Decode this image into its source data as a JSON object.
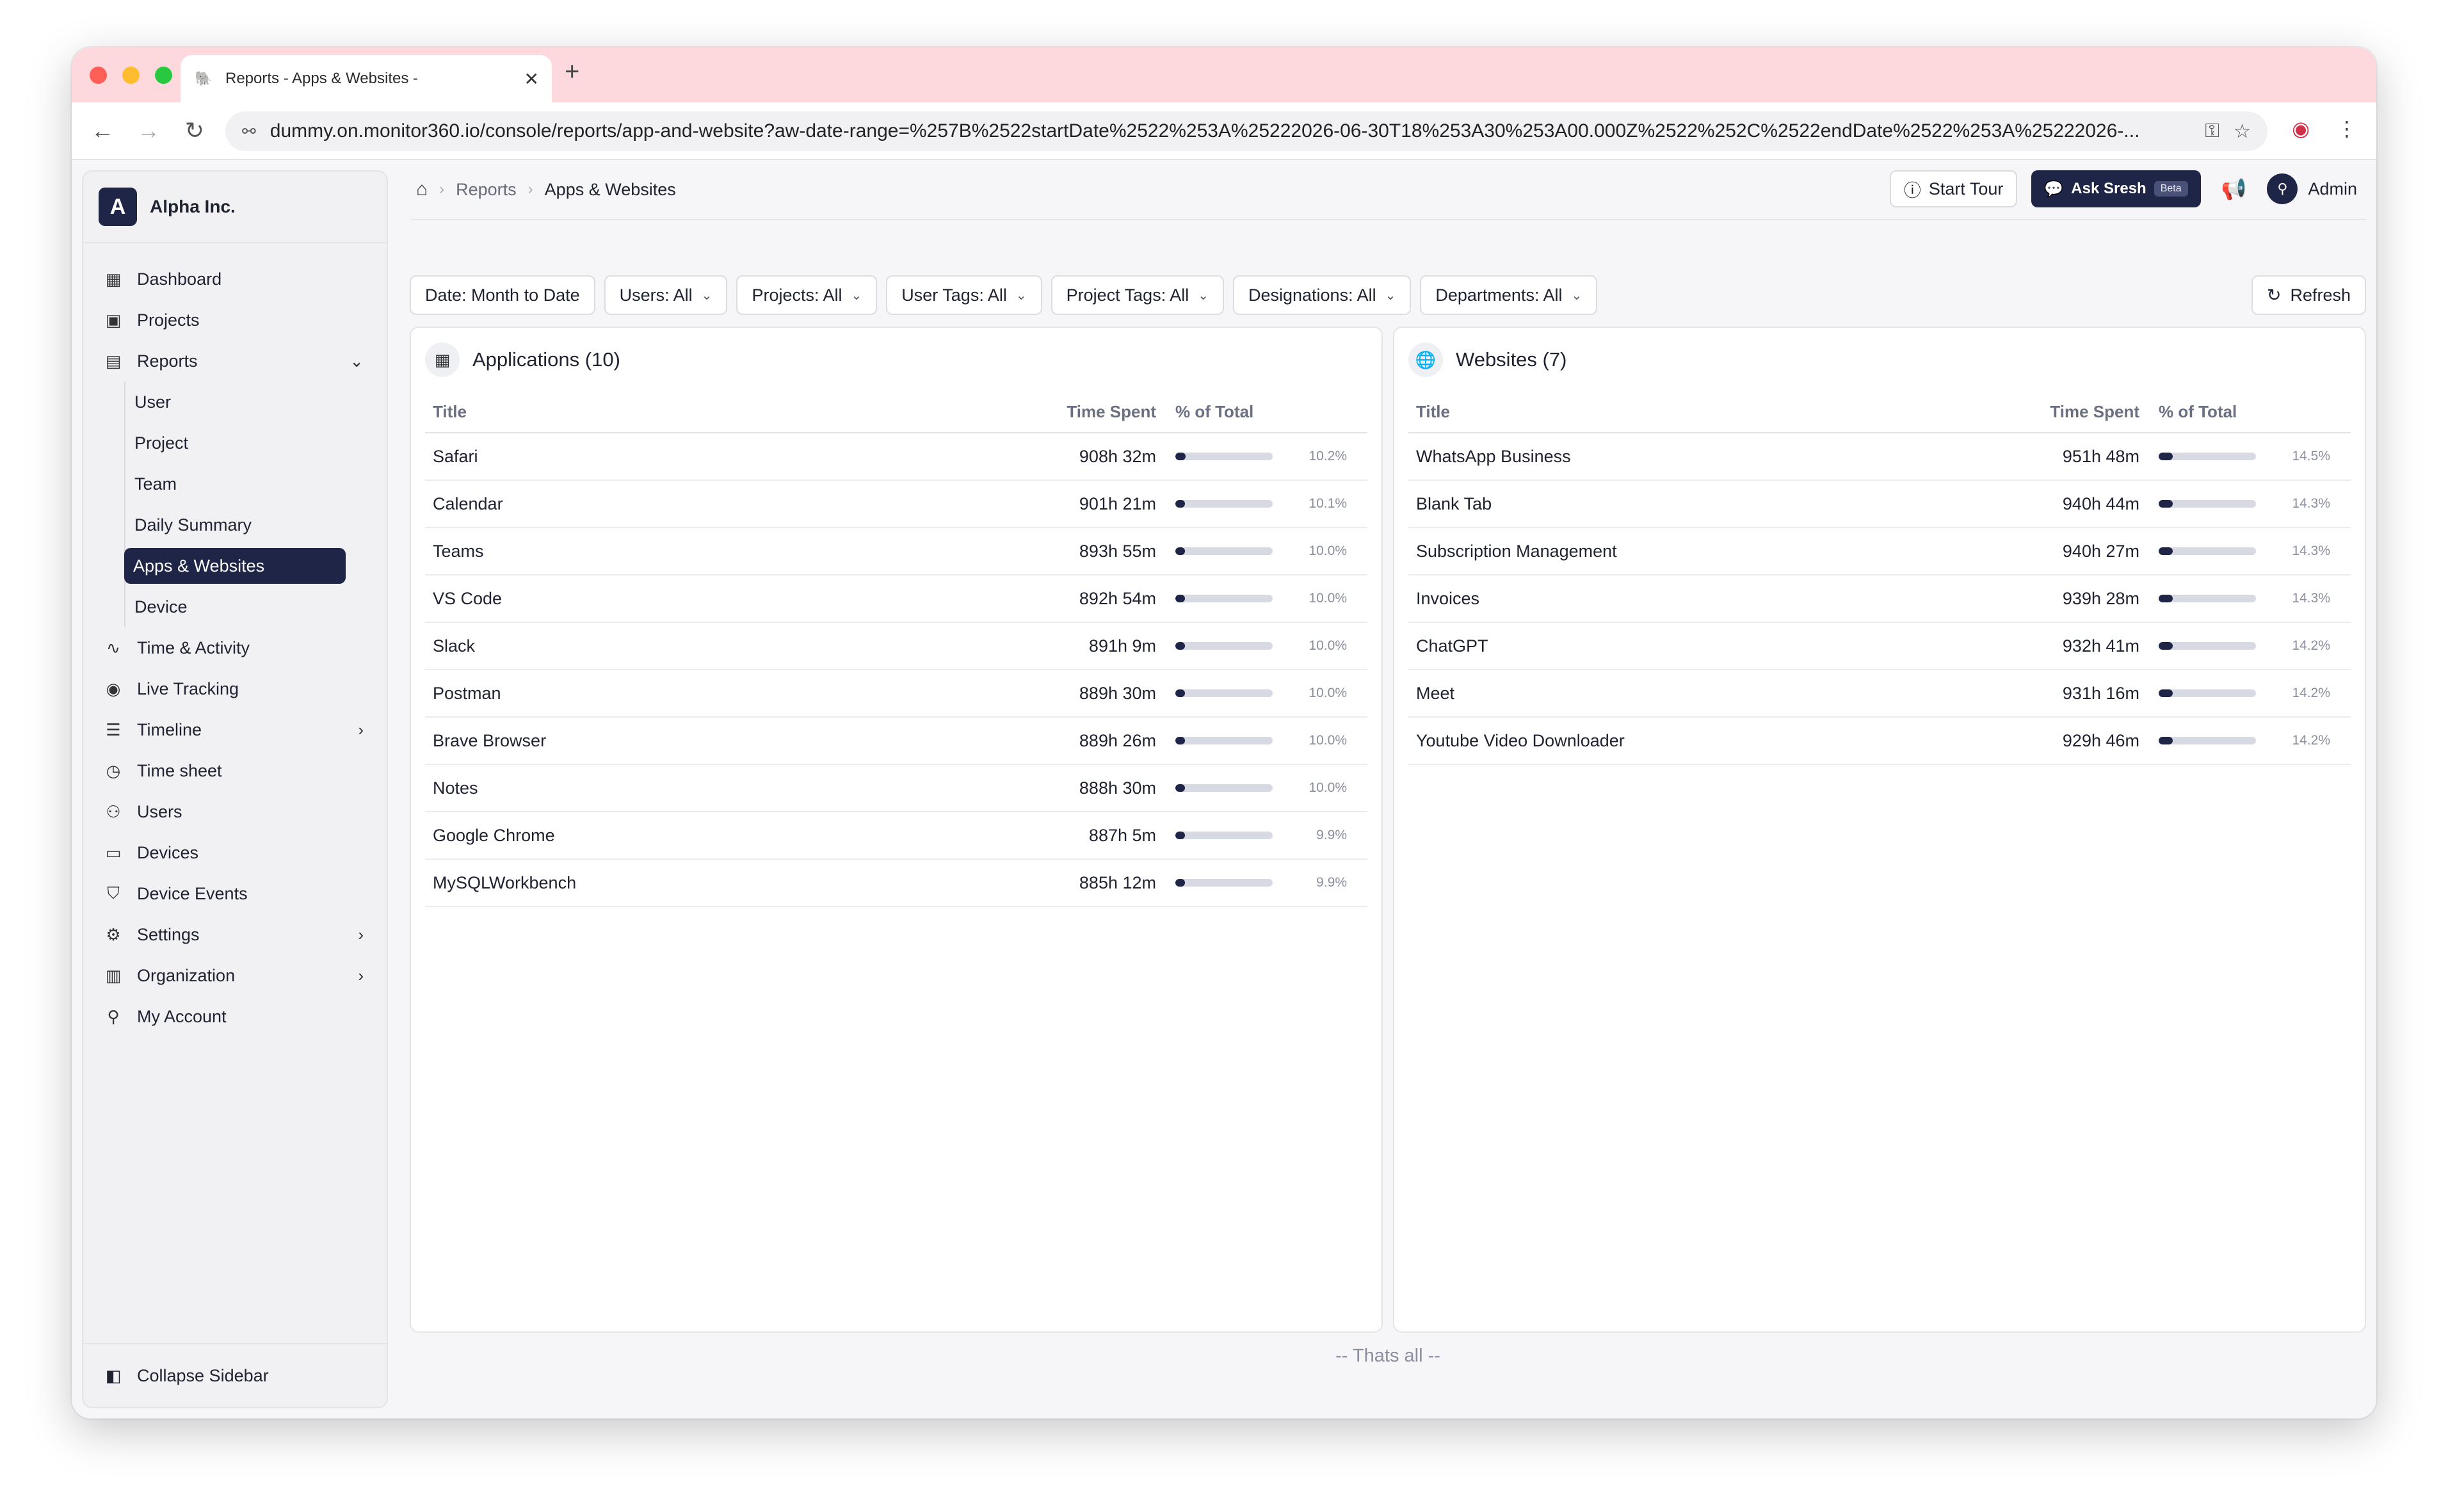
{
  "browser": {
    "tab_title": "Reports - Apps & Websites -",
    "tab_favicon": "🐘",
    "url": "dummy.on.monitor360.io/console/reports/app-and-website?aw-date-range=%257B%2522startDate%2522%253A%25222026-06-30T18%253A30%253A00.000Z%2522%252C%2522endDate%2522%253A%25222026-..."
  },
  "sidebar": {
    "brand_initial": "A",
    "brand_name": "Alpha Inc.",
    "items": [
      {
        "label": "Dashboard",
        "icon": "▦"
      },
      {
        "label": "Projects",
        "icon": "▣"
      },
      {
        "label": "Reports",
        "icon": "▤"
      },
      {
        "label": "Time & Activity",
        "icon": "∿"
      },
      {
        "label": "Live Tracking",
        "icon": "◉"
      },
      {
        "label": "Timeline",
        "icon": "☰"
      },
      {
        "label": "Time sheet",
        "icon": "◷"
      },
      {
        "label": "Users",
        "icon": "⚇"
      },
      {
        "label": "Devices",
        "icon": "▭"
      },
      {
        "label": "Device Events",
        "icon": "⛉"
      },
      {
        "label": "Settings",
        "icon": "⚙"
      },
      {
        "label": "Organization",
        "icon": "▥"
      },
      {
        "label": "My Account",
        "icon": "⚲"
      }
    ],
    "reports_sub": [
      "User",
      "Project",
      "Team",
      "Daily Summary",
      "Apps & Websites",
      "Device"
    ],
    "collapse_label": "Collapse Sidebar"
  },
  "header": {
    "breadcrumb_reports": "Reports",
    "breadcrumb_current": "Apps & Websites",
    "start_tour": "Start Tour",
    "ask_sresh": "Ask Sresh",
    "beta": "Beta",
    "admin": "Admin"
  },
  "filters": {
    "date": "Date: Month to Date",
    "users": "Users: All",
    "projects": "Projects: All",
    "user_tags": "User Tags: All",
    "project_tags": "Project Tags: All",
    "designations": "Designations: All",
    "departments": "Departments: All",
    "refresh": "Refresh"
  },
  "applications": {
    "title": "Applications (10)",
    "col_title": "Title",
    "col_time": "Time Spent",
    "col_pct": "% of Total",
    "rows": [
      {
        "title": "Safari",
        "time": "908h 32m",
        "pct": "10.2%",
        "frac": 0.102
      },
      {
        "title": "Calendar",
        "time": "901h 21m",
        "pct": "10.1%",
        "frac": 0.101
      },
      {
        "title": "Teams",
        "time": "893h 55m",
        "pct": "10.0%",
        "frac": 0.1
      },
      {
        "title": "VS Code",
        "time": "892h 54m",
        "pct": "10.0%",
        "frac": 0.1
      },
      {
        "title": "Slack",
        "time": "891h 9m",
        "pct": "10.0%",
        "frac": 0.1
      },
      {
        "title": "Postman",
        "time": "889h 30m",
        "pct": "10.0%",
        "frac": 0.1
      },
      {
        "title": "Brave Browser",
        "time": "889h 26m",
        "pct": "10.0%",
        "frac": 0.1
      },
      {
        "title": "Notes",
        "time": "888h 30m",
        "pct": "10.0%",
        "frac": 0.1
      },
      {
        "title": "Google Chrome",
        "time": "887h 5m",
        "pct": "9.9%",
        "frac": 0.099
      },
      {
        "title": "MySQLWorkbench",
        "time": "885h 12m",
        "pct": "9.9%",
        "frac": 0.099
      }
    ]
  },
  "websites": {
    "title": "Websites (7)",
    "col_title": "Title",
    "col_time": "Time Spent",
    "col_pct": "% of Total",
    "rows": [
      {
        "title": "WhatsApp Business",
        "time": "951h 48m",
        "pct": "14.5%",
        "frac": 0.145
      },
      {
        "title": "Blank Tab",
        "time": "940h 44m",
        "pct": "14.3%",
        "frac": 0.143
      },
      {
        "title": "Subscription Management",
        "time": "940h 27m",
        "pct": "14.3%",
        "frac": 0.143
      },
      {
        "title": "Invoices",
        "time": "939h 28m",
        "pct": "14.3%",
        "frac": 0.143
      },
      {
        "title": "ChatGPT",
        "time": "932h 41m",
        "pct": "14.2%",
        "frac": 0.142
      },
      {
        "title": "Meet",
        "time": "931h 16m",
        "pct": "14.2%",
        "frac": 0.142
      },
      {
        "title": "Youtube Video Downloader",
        "time": "929h 46m",
        "pct": "14.2%",
        "frac": 0.142
      }
    ]
  },
  "footer_note": "-- Thats all --",
  "colors": {
    "accent": "#1e2547",
    "tab_strip": "#fdd9de"
  }
}
